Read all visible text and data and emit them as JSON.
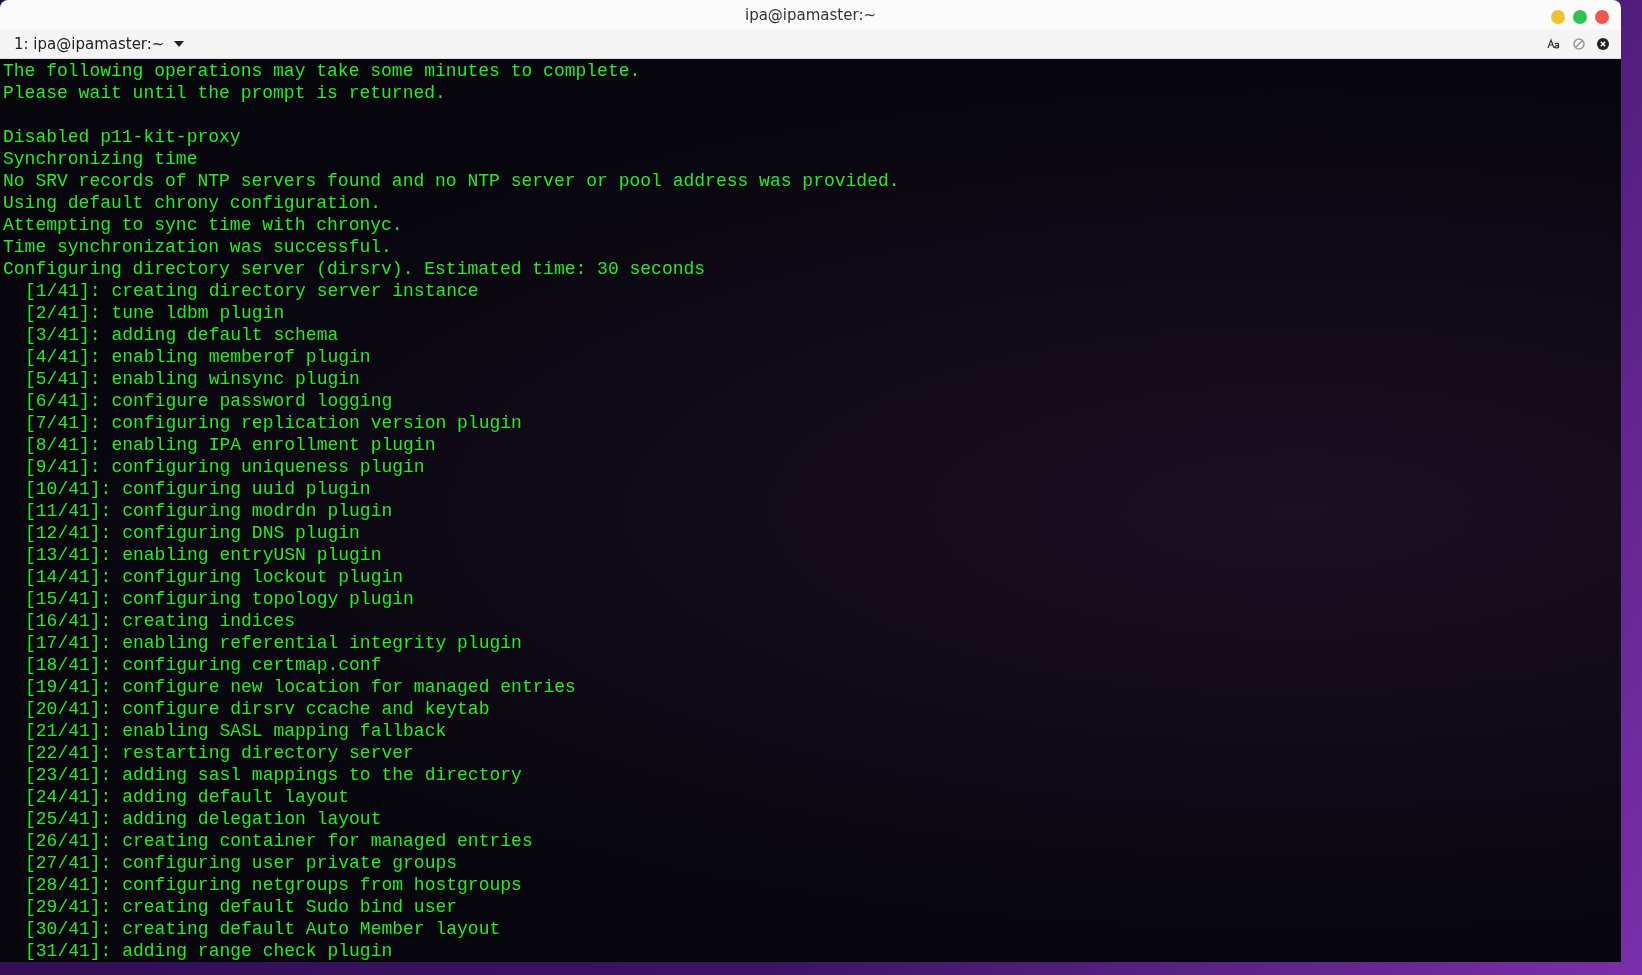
{
  "window": {
    "title": "ipa@ipamaster:~"
  },
  "tab": {
    "label": "1: ipa@ipamaster:~"
  },
  "notice": [
    "The following operations may take some minutes to complete.",
    "Please wait until the prompt is returned."
  ],
  "log": [
    {
      "kind": "plain",
      "text": "Disabled p11-kit-proxy"
    },
    {
      "kind": "plain",
      "text": "Synchronizing time"
    },
    {
      "kind": "plain",
      "text": "No SRV records of NTP servers found and no NTP server or pool address was provided."
    },
    {
      "kind": "plain",
      "text": "Using default chrony configuration."
    },
    {
      "kind": "plain",
      "text": "Attempting to sync time with chronyc."
    },
    {
      "kind": "plain",
      "text": "Time synchronization was successful."
    },
    {
      "kind": "plain",
      "text": "Configuring directory server (dirsrv). Estimated time: 30 seconds"
    },
    {
      "kind": "step",
      "text": "[1/41]: creating directory server instance"
    },
    {
      "kind": "step",
      "text": "[2/41]: tune ldbm plugin"
    },
    {
      "kind": "step",
      "text": "[3/41]: adding default schema"
    },
    {
      "kind": "step",
      "text": "[4/41]: enabling memberof plugin"
    },
    {
      "kind": "step",
      "text": "[5/41]: enabling winsync plugin"
    },
    {
      "kind": "step",
      "text": "[6/41]: configure password logging"
    },
    {
      "kind": "step",
      "text": "[7/41]: configuring replication version plugin"
    },
    {
      "kind": "step",
      "text": "[8/41]: enabling IPA enrollment plugin"
    },
    {
      "kind": "step",
      "text": "[9/41]: configuring uniqueness plugin"
    },
    {
      "kind": "step",
      "text": "[10/41]: configuring uuid plugin"
    },
    {
      "kind": "step",
      "text": "[11/41]: configuring modrdn plugin"
    },
    {
      "kind": "step",
      "text": "[12/41]: configuring DNS plugin"
    },
    {
      "kind": "step",
      "text": "[13/41]: enabling entryUSN plugin"
    },
    {
      "kind": "step",
      "text": "[14/41]: configuring lockout plugin"
    },
    {
      "kind": "step",
      "text": "[15/41]: configuring topology plugin"
    },
    {
      "kind": "step",
      "text": "[16/41]: creating indices"
    },
    {
      "kind": "step",
      "text": "[17/41]: enabling referential integrity plugin"
    },
    {
      "kind": "step",
      "text": "[18/41]: configuring certmap.conf"
    },
    {
      "kind": "step",
      "text": "[19/41]: configure new location for managed entries"
    },
    {
      "kind": "step",
      "text": "[20/41]: configure dirsrv ccache and keytab"
    },
    {
      "kind": "step",
      "text": "[21/41]: enabling SASL mapping fallback"
    },
    {
      "kind": "step",
      "text": "[22/41]: restarting directory server"
    },
    {
      "kind": "step",
      "text": "[23/41]: adding sasl mappings to the directory"
    },
    {
      "kind": "step",
      "text": "[24/41]: adding default layout"
    },
    {
      "kind": "step",
      "text": "[25/41]: adding delegation layout"
    },
    {
      "kind": "step",
      "text": "[26/41]: creating container for managed entries"
    },
    {
      "kind": "step",
      "text": "[27/41]: configuring user private groups"
    },
    {
      "kind": "step",
      "text": "[28/41]: configuring netgroups from hostgroups"
    },
    {
      "kind": "step",
      "text": "[29/41]: creating default Sudo bind user"
    },
    {
      "kind": "step",
      "text": "[30/41]: creating default Auto Member layout"
    },
    {
      "kind": "step",
      "text": "[31/41]: adding range check plugin"
    }
  ]
}
